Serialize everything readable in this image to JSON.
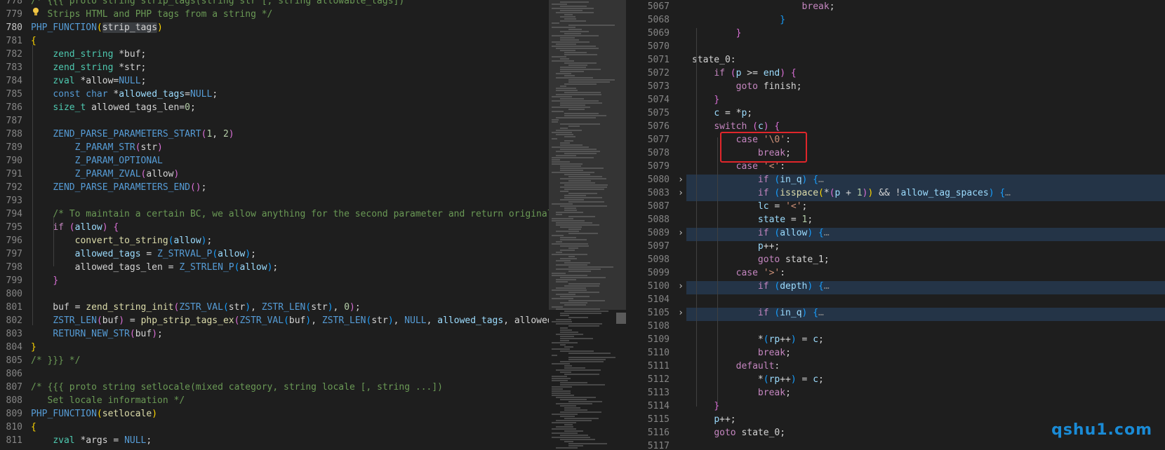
{
  "left_editor": {
    "lines": [
      {
        "n": "778",
        "html": "<span class='m'>/* {{{ proto string strip_tags(string str [, string allowable_tags])</span>"
      },
      {
        "n": "779",
        "html": "<span class='m'>   Strips HTML and PHP tags from a string */</span>"
      },
      {
        "n": "780",
        "html": "<span class='k'>PHP_FUNCTION</span><span class='p1'>(</span><span class='sel-word'>strip_tags</span><span class='p1'>)</span>"
      },
      {
        "n": "781",
        "html": "<span class='p1'>{</span>"
      },
      {
        "n": "782",
        "html": "    <span class='t'>zend_string</span> *buf;"
      },
      {
        "n": "783",
        "html": "    <span class='t'>zend_string</span> *str;"
      },
      {
        "n": "784",
        "html": "    <span class='t'>zval</span> *allow=<span class='k'>NULL</span>;"
      },
      {
        "n": "785",
        "html": "    <span class='k'>const</span> <span class='k'>char</span> *<span class='v'>allowed_tags</span>=<span class='k'>NULL</span>;"
      },
      {
        "n": "786",
        "html": "    <span class='t'>size_t</span> allowed_tags_len=<span class='n'>0</span>;"
      },
      {
        "n": "787",
        "html": ""
      },
      {
        "n": "788",
        "html": "    <span class='k'>ZEND_PARSE_PARAMETERS_START</span><span class='p2'>(</span><span class='n'>1</span>, <span class='n'>2</span><span class='p2'>)</span>"
      },
      {
        "n": "789",
        "html": "        <span class='k'>Z_PARAM_STR</span><span class='p2'>(</span>str<span class='p2'>)</span>"
      },
      {
        "n": "790",
        "html": "        <span class='k'>Z_PARAM_OPTIONAL</span>"
      },
      {
        "n": "791",
        "html": "        <span class='k'>Z_PARAM_ZVAL</span><span class='p2'>(</span>allow<span class='p2'>)</span>"
      },
      {
        "n": "792",
        "html": "    <span class='k'>ZEND_PARSE_PARAMETERS_END</span><span class='p2'>()</span>;"
      },
      {
        "n": "793",
        "html": ""
      },
      {
        "n": "794",
        "html": "    <span class='m'>/* To maintain a certain BC, we allow anything for the second parameter and return original</span>"
      },
      {
        "n": "795",
        "html": "    <span class='c'>if</span> <span class='p2'>(</span><span class='v'>allow</span><span class='p2'>)</span> <span class='p2'>{</span>"
      },
      {
        "n": "796",
        "html": "        <span class='f'>convert_to_string</span><span class='p3'>(</span><span class='v'>allow</span><span class='p3'>)</span>;"
      },
      {
        "n": "797",
        "html": "        <span class='v'>allowed_tags</span> = <span class='k'>Z_STRVAL_P</span><span class='p3'>(</span><span class='v'>allow</span><span class='p3'>)</span>;"
      },
      {
        "n": "798",
        "html": "        allowed_tags_len = <span class='k'>Z_STRLEN_P</span><span class='p3'>(</span><span class='v'>allow</span><span class='p3'>)</span>;"
      },
      {
        "n": "799",
        "html": "    <span class='p2'>}</span>"
      },
      {
        "n": "800",
        "html": ""
      },
      {
        "n": "801",
        "html": "    buf = <span class='f'>zend_string_init</span><span class='p2'>(</span><span class='k'>ZSTR_VAL</span><span class='p3'>(</span>str<span class='p3'>)</span>, <span class='k'>ZSTR_LEN</span><span class='p3'>(</span>str<span class='p3'>)</span>, <span class='n'>0</span><span class='p2'>)</span>;"
      },
      {
        "n": "802",
        "html": "    <span class='k'>ZSTR_LEN</span><span class='p2'>(</span>buf<span class='p2'>)</span> = <span class='f'>php_strip_tags_ex</span><span class='p2'>(</span><span class='k'>ZSTR_VAL</span><span class='p3'>(</span>buf<span class='p3'>)</span>, <span class='k'>ZSTR_LEN</span><span class='p3'>(</span>str<span class='p3'>)</span>, <span class='k'>NULL</span>, <span class='v'>allowed_tags</span>, allowed_"
      },
      {
        "n": "803",
        "html": "    <span class='k'>RETURN_NEW_STR</span><span class='p2'>(</span>buf<span class='p2'>)</span>;"
      },
      {
        "n": "804",
        "html": "<span class='p1'>}</span>"
      },
      {
        "n": "805",
        "html": "<span class='m'>/* }}} */</span>"
      },
      {
        "n": "806",
        "html": ""
      },
      {
        "n": "807",
        "html": "<span class='m'>/* {{{ proto string setlocale(mixed category, string locale [, string ...])</span>"
      },
      {
        "n": "808",
        "html": "<span class='m'>   Set locale information */</span>"
      },
      {
        "n": "809",
        "html": "<span class='k'>PHP_FUNCTION</span><span class='p1'>(</span><span class='f'>setlocale</span><span class='p1'>)</span>"
      },
      {
        "n": "810",
        "html": "<span class='p1'>{</span>"
      },
      {
        "n": "811",
        "html": "    <span class='t'>zval</span> *args = <span class='k'>NULL</span>;"
      }
    ]
  },
  "right_editor": {
    "lines": [
      {
        "n": "5067",
        "fold": false,
        "hl": false,
        "html": "                    <span class='c'>break</span>;"
      },
      {
        "n": "5068",
        "fold": false,
        "hl": false,
        "html": "                <span class='p3'>}</span>"
      },
      {
        "n": "5069",
        "fold": false,
        "hl": false,
        "html": "        <span class='p2'>}</span>"
      },
      {
        "n": "5070",
        "fold": false,
        "hl": false,
        "html": ""
      },
      {
        "n": "5071",
        "fold": false,
        "hl": false,
        "html": "state_0:"
      },
      {
        "n": "5072",
        "fold": false,
        "hl": false,
        "html": "    <span class='c'>if</span> <span class='p2'>(</span><span class='v'>p</span> &gt;= <span class='v'>end</span><span class='p2'>)</span> <span class='p2'>{</span>"
      },
      {
        "n": "5073",
        "fold": false,
        "hl": false,
        "html": "        <span class='c'>goto</span> finish;"
      },
      {
        "n": "5074",
        "fold": false,
        "hl": false,
        "html": "    <span class='p2'>}</span>"
      },
      {
        "n": "5075",
        "fold": false,
        "hl": false,
        "html": "    <span class='v'>c</span> = *<span class='v'>p</span>;"
      },
      {
        "n": "5076",
        "fold": false,
        "hl": false,
        "html": "    <span class='c'>switch</span> <span class='p2'>(</span><span class='v'>c</span><span class='p2'>)</span> <span class='p2'>{</span>"
      },
      {
        "n": "5077",
        "fold": false,
        "hl": false,
        "html": "        <span class='c'>case</span> <span class='s'>'\\0'</span>:"
      },
      {
        "n": "5078",
        "fold": false,
        "hl": false,
        "html": "            <span class='c'>break</span>;"
      },
      {
        "n": "5079",
        "fold": false,
        "hl": false,
        "html": "        <span class='c'>case</span> <span class='s'>'&lt;'</span>:"
      },
      {
        "n": "5080",
        "fold": true,
        "hl": true,
        "html": "            <span class='c'>if</span> <span class='p3'>(</span><span class='v'>in_q</span><span class='p3'>)</span> <span class='p3'>{</span><span class='fold'>…</span>"
      },
      {
        "n": "5083",
        "fold": true,
        "hl": true,
        "html": "            <span class='c'>if</span> <span class='p3'>(</span><span class='f'>isspace</span><span class='p1'>(</span>*<span class='p2'>(</span><span class='v'>p</span> + <span class='n'>1</span><span class='p2'>)</span><span class='p1'>)</span> &amp;&amp; !<span class='v'>allow_tag_spaces</span><span class='p3'>)</span> <span class='p3'>{</span><span class='fold'>…</span>"
      },
      {
        "n": "5087",
        "fold": false,
        "hl": false,
        "html": "            <span class='v'>lc</span> = <span class='s'>'&lt;'</span>;"
      },
      {
        "n": "5088",
        "fold": false,
        "hl": false,
        "html": "            <span class='v'>state</span> = <span class='n'>1</span>;"
      },
      {
        "n": "5089",
        "fold": true,
        "hl": true,
        "html": "            <span class='c'>if</span> <span class='p3'>(</span><span class='v'>allow</span><span class='p3'>)</span> <span class='p3'>{</span><span class='fold'>…</span>"
      },
      {
        "n": "5097",
        "fold": false,
        "hl": false,
        "html": "            <span class='v'>p</span>++;"
      },
      {
        "n": "5098",
        "fold": false,
        "hl": false,
        "html": "            <span class='c'>goto</span> state_1;"
      },
      {
        "n": "5099",
        "fold": false,
        "hl": false,
        "html": "        <span class='c'>case</span> <span class='s'>'&gt;'</span>:"
      },
      {
        "n": "5100",
        "fold": true,
        "hl": true,
        "html": "            <span class='c'>if</span> <span class='p3'>(</span><span class='v'>depth</span><span class='p3'>)</span> <span class='p3'>{</span><span class='fold'>…</span>"
      },
      {
        "n": "5104",
        "fold": false,
        "hl": false,
        "html": ""
      },
      {
        "n": "5105",
        "fold": true,
        "hl": true,
        "html": "            <span class='c'>if</span> <span class='p3'>(</span><span class='v'>in_q</span><span class='p3'>)</span> <span class='p3'>{</span><span class='fold'>…</span>"
      },
      {
        "n": "5108",
        "fold": false,
        "hl": false,
        "html": ""
      },
      {
        "n": "5109",
        "fold": false,
        "hl": false,
        "html": "            *<span class='p3'>(</span><span class='v'>rp</span>++<span class='p3'>)</span> = <span class='v'>c</span>;"
      },
      {
        "n": "5110",
        "fold": false,
        "hl": false,
        "html": "            <span class='c'>break</span>;"
      },
      {
        "n": "5111",
        "fold": false,
        "hl": false,
        "html": "        <span class='c'>default</span>:"
      },
      {
        "n": "5112",
        "fold": false,
        "hl": false,
        "html": "            *<span class='p3'>(</span><span class='v'>rp</span>++<span class='p3'>)</span> = <span class='v'>c</span>;"
      },
      {
        "n": "5113",
        "fold": false,
        "hl": false,
        "html": "            <span class='c'>break</span>;"
      },
      {
        "n": "5114",
        "fold": false,
        "hl": false,
        "html": "    <span class='p2'>}</span>"
      },
      {
        "n": "5115",
        "fold": false,
        "hl": false,
        "html": "    <span class='v'>p</span>++;"
      },
      {
        "n": "5116",
        "fold": false,
        "hl": false,
        "html": "    <span class='c'>goto</span> state_0;"
      },
      {
        "n": "5117",
        "fold": false,
        "hl": false,
        "html": ""
      }
    ]
  },
  "watermark": "qshu1.com",
  "colors": {
    "background": "#1e1e1e",
    "highlight_box": "#e0262b",
    "watermark": "#1a8bd6"
  }
}
